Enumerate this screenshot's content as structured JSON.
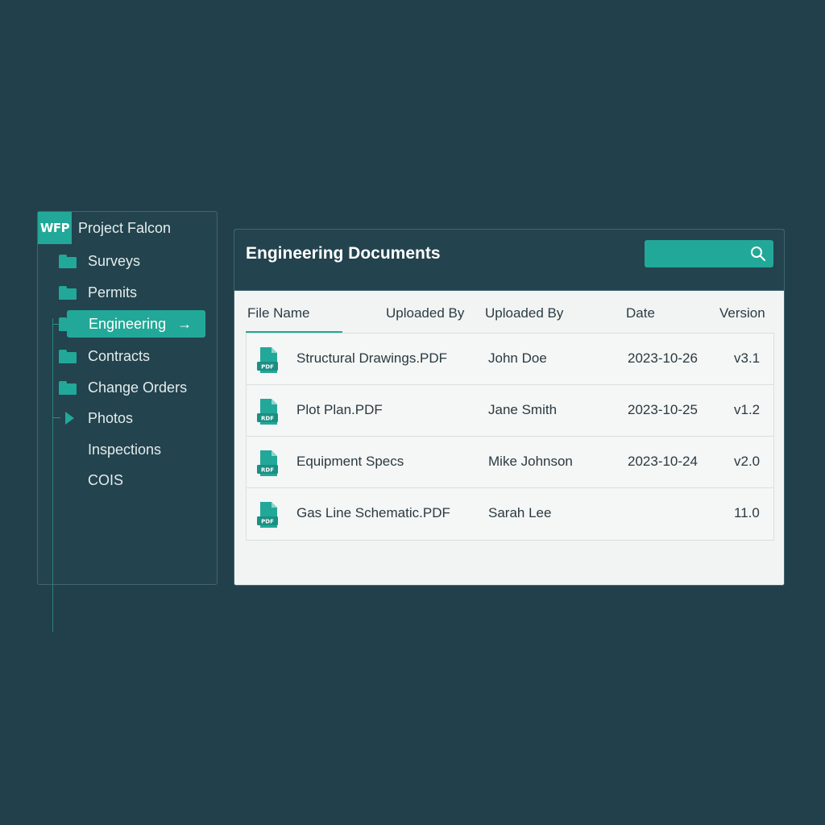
{
  "sidebar": {
    "logo_text": "WFP",
    "project_name": "Project Falcon",
    "items": [
      {
        "label": "Surveys",
        "icon": "folder-icon"
      },
      {
        "label": "Permits",
        "icon": "folder-icon"
      },
      {
        "label": "Engineering",
        "icon": "arrow-right-icon",
        "active": true
      },
      {
        "label": "Contracts",
        "icon": "folder-icon"
      },
      {
        "label": "Change Orders",
        "icon": "folder-icon"
      },
      {
        "label": "Photos",
        "icon": "play-icon"
      },
      {
        "label": "Inspections",
        "icon": ""
      },
      {
        "label": "COIS",
        "icon": ""
      }
    ],
    "active_arrow": "→"
  },
  "panel": {
    "title": "Engineering Documents",
    "search": {
      "placeholder": ""
    },
    "columns": [
      "File Name",
      "Uploaded By",
      "Uploaded By",
      "Date",
      "Version"
    ],
    "rows": [
      {
        "file": "Structural Drawings.PDF",
        "uploaded_by": "John Doe",
        "date": "2023-10-26",
        "version": "v3.1",
        "icon_text": "PDF"
      },
      {
        "file": "Plot Plan.PDF",
        "uploaded_by": "Jane Smith",
        "date": "2023-10-25",
        "version": "v1.2",
        "icon_text": "RDF"
      },
      {
        "file": "Equipment Specs",
        "uploaded_by": "Mike Johnson",
        "date": "2023-10-24",
        "version": "v2.0",
        "icon_text": "RDF"
      },
      {
        "file": "Gas Line Schematic.PDF",
        "uploaded_by": "Sarah Lee",
        "date": "",
        "version": "11.0",
        "icon_text": "PDF"
      }
    ]
  },
  "colors": {
    "background": "#22404b",
    "accent": "#22a898",
    "panel": "#f2f4f4"
  }
}
